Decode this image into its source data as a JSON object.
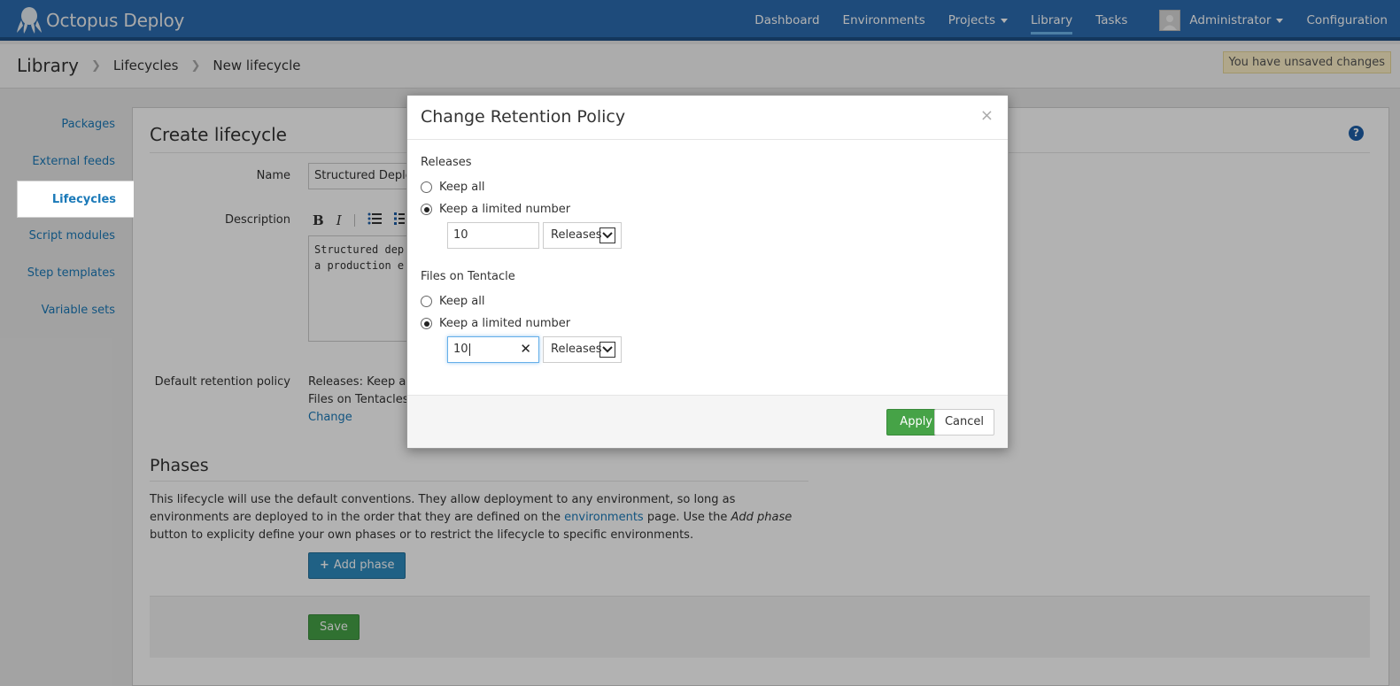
{
  "app": {
    "brand": "Octopus Deploy"
  },
  "nav": {
    "items": [
      "Dashboard",
      "Environments",
      "Projects",
      "Library",
      "Tasks"
    ],
    "user": "Administrator",
    "configuration": "Configuration"
  },
  "breadcrumb": {
    "root": "Library",
    "items": [
      "Lifecycles",
      "New lifecycle"
    ]
  },
  "unsaved_notice": "You have unsaved changes",
  "sidebar": {
    "items": [
      {
        "label": "Packages"
      },
      {
        "label": "External feeds"
      },
      {
        "label": "Lifecycles"
      },
      {
        "label": "Script modules"
      },
      {
        "label": "Step templates"
      },
      {
        "label": "Variable sets"
      }
    ]
  },
  "form": {
    "title": "Create lifecycle",
    "name_label": "Name",
    "name_value": "Structured Deploy",
    "description_label": "Description",
    "description_value": "Structured dep\na production e",
    "retention_label": "Default retention policy",
    "retention_releases": "Releases: Keep all",
    "retention_files": "Files on Tentacles:",
    "change_link": "Change"
  },
  "phases": {
    "title": "Phases",
    "text_before_link": "This lifecycle will use the default conventions. They allow deployment to any environment, so long as environments are deployed to in the order that they are defined on the ",
    "link": "environments",
    "text_after_link": " page. Use the ",
    "italic": "Add phase",
    "text_end": " button to explicity define your own phases or to restrict the lifecycle to specific environments.",
    "add_button": "Add phase",
    "save_button": "Save"
  },
  "modal": {
    "title": "Change Retention Policy",
    "close": "×",
    "releases": {
      "label": "Releases",
      "keep_all": "Keep all",
      "keep_limited": "Keep a limited number",
      "value": "10",
      "unit": "Releases"
    },
    "files": {
      "label": "Files on Tentacle",
      "keep_all": "Keep all",
      "keep_limited": "Keep a limited number",
      "value": "10",
      "unit": "Releases"
    },
    "apply": "Apply",
    "cancel": "Cancel"
  }
}
